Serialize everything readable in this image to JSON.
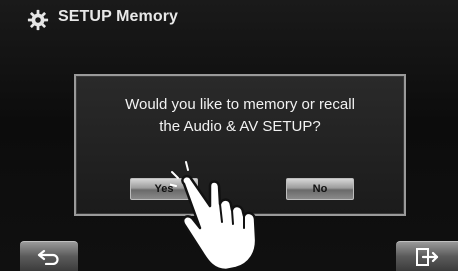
{
  "header": {
    "title": "SETUP Memory",
    "icon": "gear-icon"
  },
  "dialog": {
    "message_line1": "Would you like to memory or recall",
    "message_line2": "the Audio & AV SETUP?",
    "yes_label": "Yes",
    "no_label": "No"
  },
  "footer": {
    "back_icon": "back-arrow-icon",
    "exit_icon": "exit-icon"
  },
  "overlay": {
    "pointer": "pointing-hand-icon"
  },
  "colors": {
    "background": "#0c0c0c",
    "dialog_border": "#9a9a9a",
    "text": "#f2f2f2"
  }
}
